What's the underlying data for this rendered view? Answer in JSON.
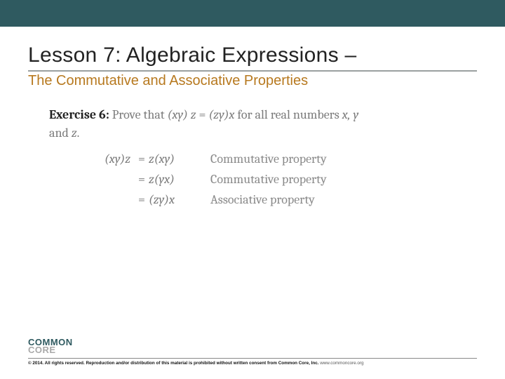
{
  "header": {
    "title": "Lesson 7: Algebraic Expressions –",
    "subtitle": "The Commutative and Associative Properties"
  },
  "exercise": {
    "label": "Exercise 6:",
    "prompt_pre": "Prove that ",
    "prompt_expr_lhs": "(xy) z",
    "prompt_eq": " = ",
    "prompt_expr_rhs": "(zy)x",
    "prompt_mid": " for all real numbers ",
    "vars": "x, y",
    "and": "and ",
    "last_var": "z",
    "period": "."
  },
  "proof": [
    {
      "lhs": "(xy)z",
      "eq": "=",
      "rhs": "z(xy)",
      "reason": "Commutative property"
    },
    {
      "lhs": "",
      "eq": "=",
      "rhs": "z(yx)",
      "reason": "Commutative property"
    },
    {
      "lhs": "",
      "eq": "=",
      "rhs": "(zy)x",
      "reason": "Associative property"
    }
  ],
  "footer": {
    "logo1": "COMMON",
    "logo2": "CORE",
    "copyright_bold": "© 2014. All rights reserved. Reproduction and/or distribution of this material is prohibited without written consent from Common Core, Inc.",
    "copyright_link": "www.commoncore.org"
  }
}
